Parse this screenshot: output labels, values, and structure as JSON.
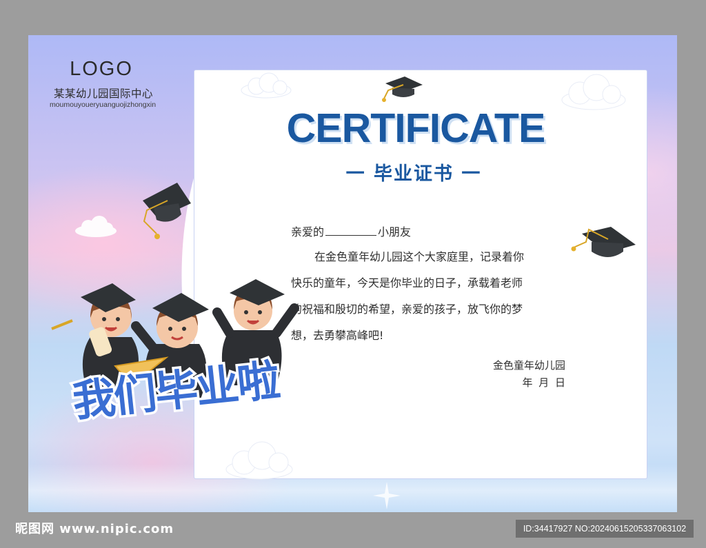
{
  "logo_text": "LOGO",
  "school_name": "某某幼儿园国际中心",
  "school_pinyin": "moumouyoueryuanguojizhongxin",
  "title": "CERTIFICATE",
  "subtitle": "一 毕业证书 一",
  "salutation": {
    "prefix": "亲爱的",
    "suffix": "小朋友"
  },
  "message_lines": [
    "在金色童年幼儿园这个大家庭里，记录着你",
    "快乐的童年，今天是你毕业的日子，承载着老师",
    "的祝福和殷切的希望，亲爱的孩子，放飞你的梦",
    "想，去勇攀高峰吧!"
  ],
  "signature": "金色童年幼儿园",
  "date_line": "年  月  日",
  "art_text": "我们毕业啦",
  "watermark": {
    "site": "昵图网 www.nipic.com",
    "id_line": "ID:34417927 NO:20240615205337063102"
  },
  "colors": {
    "title_blue": "#1a58a0",
    "frame_gray": "#9d9d9d"
  }
}
